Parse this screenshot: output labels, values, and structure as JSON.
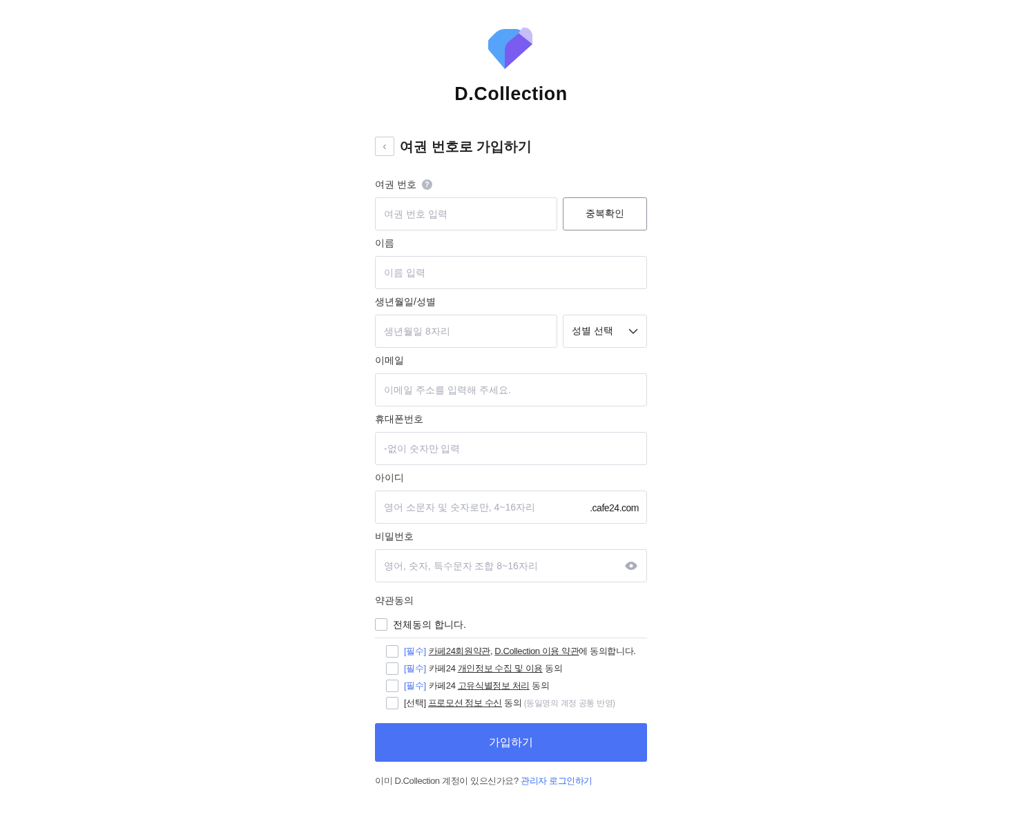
{
  "brand": {
    "name": "D.Collection"
  },
  "heading": {
    "back": "‹",
    "title": "여권 번호로 가입하기"
  },
  "fields": [
    {
      "kind": "button",
      "label": "여권 번호",
      "help": "?",
      "placeholder": "여권 번호 입력",
      "button": "중복확인"
    },
    {
      "kind": "text",
      "label": "이름",
      "placeholder": "이름 입력"
    },
    {
      "kind": "select",
      "label": "생년월일/성별",
      "placeholder": "생년월일 8자리",
      "select": "성별 선택"
    },
    {
      "kind": "text",
      "label": "이메일",
      "placeholder": "이메일 주소를 입력해 주세요."
    },
    {
      "kind": "text",
      "label": "휴대폰번호",
      "placeholder": "-없이 숫자만 입력"
    },
    {
      "kind": "suffix",
      "label": "아이디",
      "placeholder": "영어 소문자 및 숫자로만, 4~16자리",
      "suffix": ".cafe24.com"
    },
    {
      "kind": "password",
      "label": "비밀번호",
      "placeholder": "영어, 숫자, 특수문자 조합 8~16자리"
    }
  ],
  "terms": {
    "label": "약관동의",
    "all": {
      "text": "전체동의 합니다.",
      "checked": false
    },
    "items": [
      {
        "checked": false,
        "parts": [
          {
            "kind": "tag",
            "text": "[필수]"
          },
          {
            "kind": "link",
            "text": "카페24회원약관"
          },
          {
            "kind": "plain",
            "text": ", "
          },
          {
            "kind": "link",
            "text": "D.Collection 이용 약관"
          },
          {
            "kind": "plain",
            "text": "에 동의합니다."
          }
        ]
      },
      {
        "checked": false,
        "parts": [
          {
            "kind": "tag",
            "text": "[필수]"
          },
          {
            "kind": "plain",
            "text": "카페24 "
          },
          {
            "kind": "link",
            "text": "개인정보 수집 및 이용"
          },
          {
            "kind": "plain",
            "text": " 동의"
          }
        ]
      },
      {
        "checked": false,
        "parts": [
          {
            "kind": "tag",
            "text": "[필수]"
          },
          {
            "kind": "plain",
            "text": "카페24 "
          },
          {
            "kind": "link",
            "text": "고유식별정보 처리"
          },
          {
            "kind": "plain",
            "text": " 동의"
          }
        ]
      },
      {
        "checked": false,
        "parts": [
          {
            "kind": "plain",
            "text": "[선택] "
          },
          {
            "kind": "link",
            "text": "프로모션 정보 수신"
          },
          {
            "kind": "plain",
            "text": " 동의 "
          },
          {
            "kind": "note",
            "text": "(동일명의 계정 공통 반영)"
          }
        ]
      }
    ]
  },
  "submit": "가입하기",
  "footer": {
    "text": "이미 D.Collection 계정이 있으신가요?",
    "link": "관리자 로그인하기"
  }
}
